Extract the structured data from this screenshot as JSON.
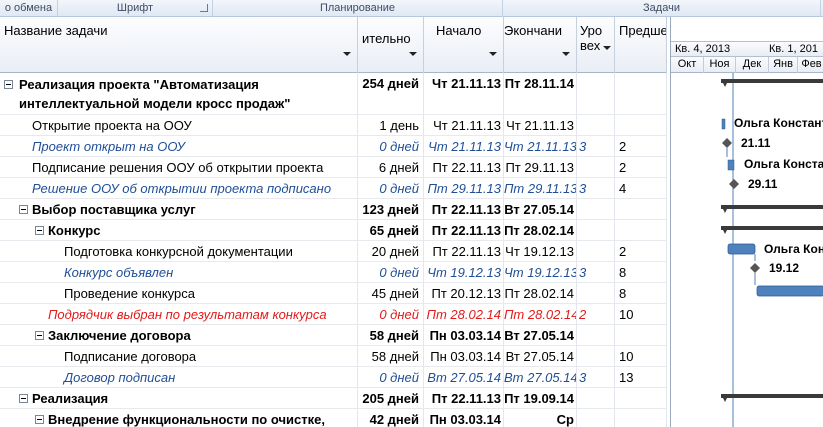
{
  "ribbon": {
    "groups": [
      "о обмена",
      "Шрифт",
      "Планирование",
      "Задачи"
    ]
  },
  "columns": {
    "name": "Название задачи",
    "duration": "ительно",
    "start": "Начало",
    "end": "Экончани",
    "level_l1": "Уро",
    "level_l2": "вех",
    "pred": "Предше"
  },
  "rows": [
    {
      "name_l1": "Реализация проекта \"Автоматизация",
      "name_l2": "интеллектуальной модели кросс продаж\"",
      "dur": "254 дней",
      "start": "Чт 21.11.13",
      "end": "Пт 28.11.14",
      "lvl": "",
      "pred": ""
    },
    {
      "name": "Открытие проекта на ООУ",
      "dur": "1 день",
      "start": "Чт 21.11.13",
      "end": "Чт 21.11.13",
      "lvl": "",
      "pred": ""
    },
    {
      "name": "Проект открыт на ООУ",
      "dur": "0 дней",
      "start": "Чт 21.11.13",
      "end": "Чт 21.11.13",
      "lvl": "3",
      "pred": "2"
    },
    {
      "name": "Подписание решения ООУ об открытии проекта",
      "dur": "6 дней",
      "start": "Пт 22.11.13",
      "end": "Пт 29.11.13",
      "lvl": "",
      "pred": "2"
    },
    {
      "name": "Решение ООУ об открытии проекта подписано",
      "dur": "0 дней",
      "start": "Пт 29.11.13",
      "end": "Пт 29.11.13",
      "lvl": "3",
      "pred": "4"
    },
    {
      "name": "Выбор поставщика услуг",
      "dur": "123 дней",
      "start": "Пт 22.11.13",
      "end": "Вт 27.05.14",
      "lvl": "",
      "pred": ""
    },
    {
      "name": "Конкурс",
      "dur": "65 дней",
      "start": "Пт 22.11.13",
      "end": "Пт 28.02.14",
      "lvl": "",
      "pred": ""
    },
    {
      "name": "Подготовка конкурсной документации",
      "dur": "20 дней",
      "start": "Пт 22.11.13",
      "end": "Чт 19.12.13",
      "lvl": "",
      "pred": "2"
    },
    {
      "name": "Конкурс объявлен",
      "dur": "0 дней",
      "start": "Чт 19.12.13",
      "end": "Чт 19.12.13",
      "lvl": "3",
      "pred": "8"
    },
    {
      "name": "Проведение конкурса",
      "dur": "45 дней",
      "start": "Пт 20.12.13",
      "end": "Пт 28.02.14",
      "lvl": "",
      "pred": "8"
    },
    {
      "name": "Подрядчик выбран по результатам конкурса",
      "dur": "0 дней",
      "start": "Пт 28.02.14",
      "end": "Пт 28.02.14",
      "lvl": "2",
      "pred": "10"
    },
    {
      "name": "Заключение договора",
      "dur": "58 дней",
      "start": "Пн 03.03.14",
      "end": "Вт 27.05.14",
      "lvl": "",
      "pred": ""
    },
    {
      "name": "Подписание договора",
      "dur": "58 дней",
      "start": "Пн 03.03.14",
      "end": "Вт 27.05.14",
      "lvl": "",
      "pred": "10"
    },
    {
      "name": "Договор подписан",
      "dur": "0 дней",
      "start": "Вт 27.05.14",
      "end": "Вт 27.05.14",
      "lvl": "3",
      "pred": "13"
    },
    {
      "name": "Реализация",
      "dur": "205 дней",
      "start": "Пт 22.11.13",
      "end": "Пт 19.09.14",
      "lvl": "",
      "pred": ""
    },
    {
      "name": "Внедрение функциональности по очистке,",
      "dur": "42 дней",
      "start": "Пн 03.03.14",
      "end": "Ср",
      "lvl": "",
      "pred": ""
    }
  ],
  "gantt": {
    "quarters": [
      "Кв. 4, 2013",
      "Кв. 1, 201"
    ],
    "months": [
      "Окт",
      "Ноя",
      "Дек",
      "Янв",
      "Фев"
    ],
    "labels": {
      "resource1": "Ольга Констант",
      "date1": "21.11",
      "resource2": "Ольга Констан",
      "date2": "29.11",
      "resource3": "Ольга Кон",
      "date3": "19.12"
    },
    "colors": {
      "bar": "#4f81bd",
      "summary": "#3a3a3a",
      "milestone": "#555555"
    }
  }
}
